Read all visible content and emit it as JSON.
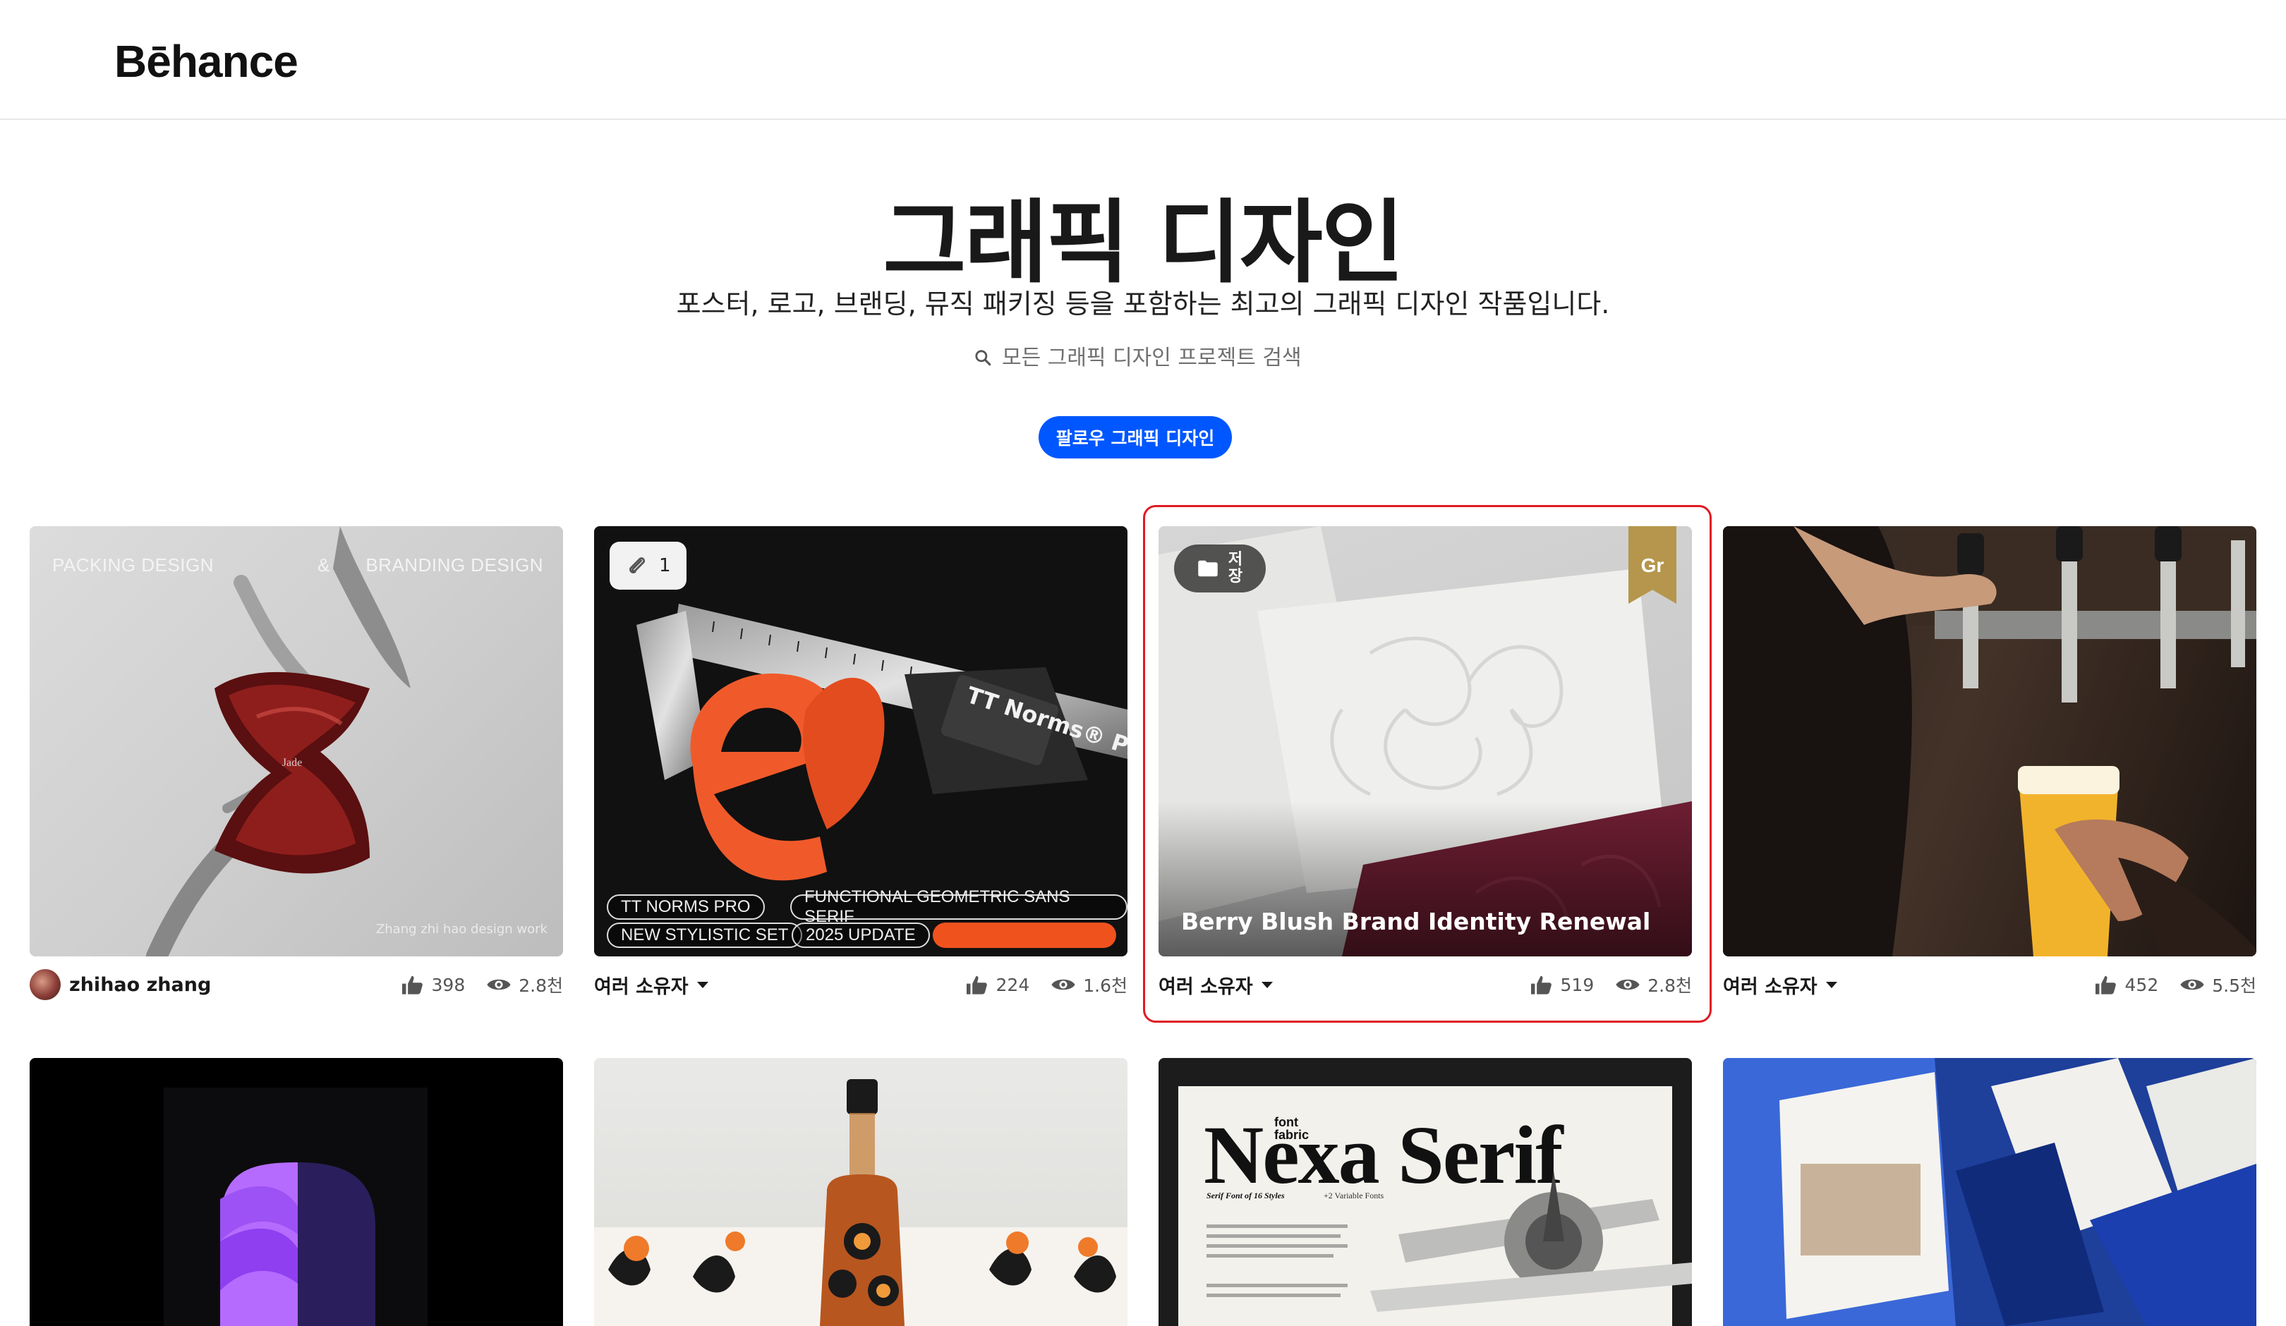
{
  "header": {
    "logo": "Bēhance"
  },
  "hero": {
    "title": "그래픽 디자인",
    "subtitle": "포스터, 로고, 브랜딩, 뮤직 패키징 등을 포함하는 최고의 그래픽 디자인 작품입니다.",
    "search_placeholder": "모든 그래픽 디자인 프로젝트 검색",
    "follow_label": "팔로우 그래픽 디자인"
  },
  "projects": [
    {
      "owner": "zhihao zhang",
      "likes": "398",
      "views": "2.8천",
      "thumb_text": {
        "left": "PACKING DESIGN",
        "mid": "&",
        "right": "BRANDING DESIGN",
        "credit": "Zhang zhi hao design work",
        "brand": "Jade"
      }
    },
    {
      "owner": "여러 소유자",
      "likes": "224",
      "views": "1.6천",
      "attachments": "1",
      "thumb_text": {
        "badge_title": "TT Norms® Pro Update",
        "tag1": "TT NORMS PRO",
        "tag2": "FUNCTIONAL GEOMETRIC SANS SERIF",
        "tag3": "NEW STYLISTIC SET",
        "tag4": "2025 UPDATE"
      }
    },
    {
      "owner": "여러 소유자",
      "likes": "519",
      "views": "2.8천",
      "title": "Berry Blush Brand Identity Renewal",
      "save_label_1": "저",
      "save_label_2": "장",
      "ribbon": "Gr"
    },
    {
      "owner": "여러 소유자",
      "likes": "452",
      "views": "5.5천"
    },
    {
      "thumb": "purple-3d-shape"
    },
    {
      "thumb": "bottle-packaging"
    },
    {
      "thumb_text": {
        "title": "Nexa Serif",
        "maker": "font fabric",
        "caption": "Serif Font of 16 Styles",
        "tag": "+2 Variable Fonts"
      }
    },
    {
      "thumb": "blue-brand-stationery"
    }
  ],
  "colors": {
    "accent": "#0057ff",
    "selection": "#e01a22"
  }
}
